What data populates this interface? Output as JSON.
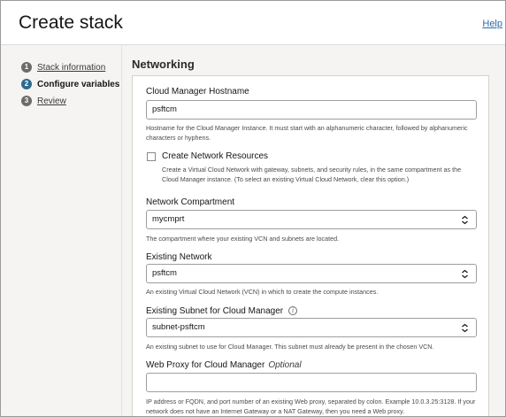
{
  "header": {
    "title": "Create stack",
    "help_label": "Help"
  },
  "steps": [
    {
      "number": "1",
      "label": "Stack information",
      "active": false
    },
    {
      "number": "2",
      "label": "Configure variables",
      "active": true
    },
    {
      "number": "3",
      "label": "Review",
      "active": false
    }
  ],
  "section": {
    "title": "Networking"
  },
  "fields": {
    "hostname": {
      "label": "Cloud Manager Hostname",
      "value": "psftcm",
      "help": "Hostname for the Cloud Manager Instance. It must start with an alphanumeric character, followed by alphanumeric characters or hyphens."
    },
    "create_network": {
      "label": "Create Network Resources",
      "checked": false,
      "help": "Create a Virtual Cloud Network with gateway, subnets, and security rules, in the same compartment as the Cloud Manager instance. (To select an existing Virtual Cloud Network, clear this option.)"
    },
    "network_compartment": {
      "label": "Network Compartment",
      "value": "mycmprt",
      "help": "The compartment where your existing VCN and subnets are located."
    },
    "existing_network": {
      "label": "Existing Network",
      "value": "psftcm",
      "help": "An existing Virtual Cloud Network (VCN) in which to create the compute instances."
    },
    "existing_subnet": {
      "label": "Existing Subnet for Cloud Manager",
      "info_icon": "info-icon",
      "value": "subnet-psftcm",
      "help": "An existing subnet to use for Cloud Manager. This subnet must already be present in the chosen VCN."
    },
    "web_proxy": {
      "label": "Web Proxy for Cloud Manager",
      "optional_label": "Optional",
      "value": "",
      "help": "IP address or FQDN, and port number of an existing Web proxy, separated by colon. Example 10.0.3.25:3128. If your network does not have an Internet Gateway or a NAT Gateway, then you need a Web proxy."
    }
  }
}
